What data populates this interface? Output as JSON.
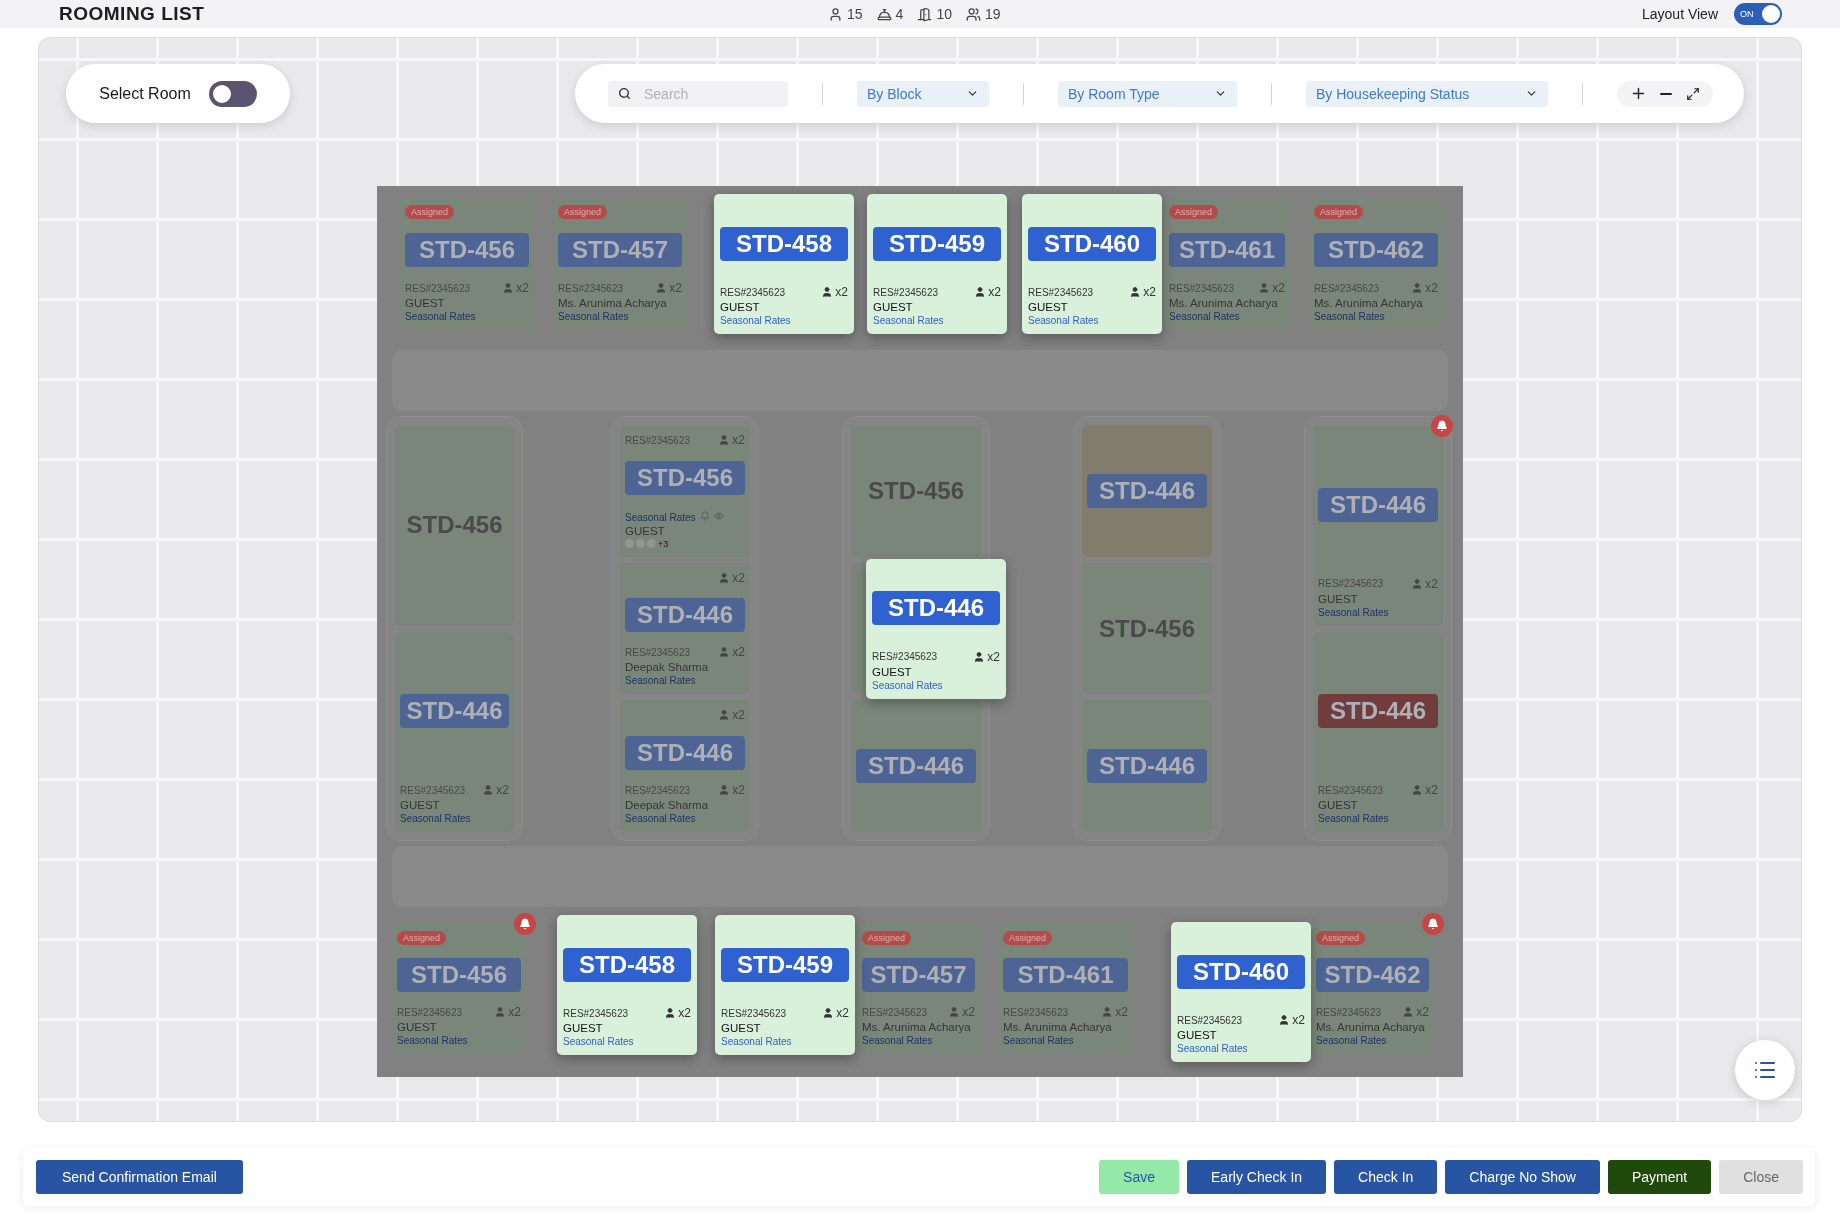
{
  "header": {
    "title": "ROOMING LIST",
    "counts": [
      {
        "kind": "person",
        "value": "15"
      },
      {
        "kind": "service",
        "value": "4"
      },
      {
        "kind": "door",
        "value": "10"
      },
      {
        "kind": "group",
        "value": "19"
      }
    ],
    "layout_view": {
      "label": "Layout View",
      "state_text": "ON",
      "on": true
    }
  },
  "select_room": {
    "label": "Select Room",
    "on": false
  },
  "filters": {
    "search": {
      "placeholder": "Search"
    },
    "dropdowns": [
      "By Block",
      "By Room Type",
      "By Housekeeping Status"
    ]
  },
  "floor_plan": {
    "top_row": [
      {
        "kind": "occupied",
        "room": "STD-456",
        "badge": "Assigned",
        "reservation": "RES#2345623",
        "guests": "x2",
        "guest": "GUEST",
        "rate": "Seasonal Rates",
        "highlighted": false,
        "color": "#7b867a",
        "tag": {
          "color": "#4d6494"
        },
        "alert": false
      },
      {
        "kind": "occupied",
        "room": "STD-457",
        "badge": "Assigned",
        "reservation": "RES#2345623",
        "guests": "x2",
        "guest": "Ms. Arunima Acharya",
        "rate": "Seasonal Rates",
        "highlighted": false,
        "color": "#7b867a",
        "tag": {
          "color": "#4d6494"
        },
        "alert": false
      },
      {
        "kind": "occupied",
        "room": "STD-458",
        "reservation": "RES#2345623",
        "guests": "x2",
        "guest": "GUEST",
        "rate": "Seasonal Rates",
        "highlighted": true,
        "color": "#d9f0da",
        "tag": {
          "color": "#2f62d0"
        },
        "alert": false
      },
      {
        "kind": "occupied",
        "room": "STD-459",
        "reservation": "RES#2345623",
        "guests": "x2",
        "guest": "GUEST",
        "rate": "Seasonal Rates",
        "highlighted": true,
        "color": "#d9f0da",
        "tag": {
          "color": "#2f62d0"
        },
        "alert": false
      },
      {
        "kind": "occupied",
        "room": "STD-460",
        "reservation": "RES#2345623",
        "guests": "x2",
        "guest": "GUEST",
        "rate": "Seasonal Rates",
        "highlighted": true,
        "color": "#d9f0da",
        "tag": {
          "color": "#2f62d0"
        },
        "alert": false
      },
      {
        "kind": "occupied",
        "room": "STD-461",
        "badge": "Assigned",
        "reservation": "RES#2345623",
        "guests": "x2",
        "guest": "Ms. Arunima Acharya",
        "rate": "Seasonal Rates",
        "highlighted": false,
        "color": "#7b867a",
        "tag": {
          "color": "#4d6494"
        },
        "alert": false
      },
      {
        "kind": "occupied",
        "room": "STD-462",
        "badge": "Assigned",
        "reservation": "RES#2345623",
        "guests": "x2",
        "guest": "Ms. Arunima Acharya",
        "rate": "Seasonal Rates",
        "highlighted": false,
        "color": "#7b867a",
        "tag": {
          "color": "#4d6494"
        },
        "alert": false
      }
    ],
    "blocks": [
      {
        "rooms": [
          {
            "kind": "vacant",
            "room": "STD-456",
            "highlighted": false,
            "color": "#7b867a",
            "alert": false
          },
          {
            "kind": "occupied",
            "room": "STD-446",
            "reservation": "RES#2345623",
            "guests": "x2",
            "guest": "GUEST",
            "rate": "Seasonal Rates",
            "highlighted": false,
            "color": "#7b867a",
            "tag": {
              "color": "#4d6494"
            },
            "alert": false
          }
        ]
      },
      {
        "rooms": [
          {
            "kind": "detailed",
            "room": "STD-456",
            "reservation": "RES#2345623",
            "guests": "x2",
            "guest": "GUEST",
            "rate": "Seasonal Rates",
            "more": "+3",
            "highlighted": false,
            "color": "#7b867a",
            "tag": {
              "color": "#4d6494"
            },
            "alert": false
          },
          {
            "kind": "occupied",
            "room": "STD-446",
            "top_guests": "x2",
            "reservation": "RES#2345623",
            "guests": "x2",
            "guest": "Deepak Sharma",
            "rate": "Seasonal Rates",
            "highlighted": false,
            "color": "#7b867a",
            "tag": {
              "color": "#4d6494"
            },
            "alert": false
          },
          {
            "kind": "occupied",
            "room": "STD-446",
            "top_guests": "x2",
            "reservation": "RES#2345623",
            "guests": "x2",
            "guest": "Deepak Sharma",
            "rate": "Seasonal Rates",
            "highlighted": false,
            "color": "#7b867a",
            "tag": {
              "color": "#4d6494"
            },
            "alert": false
          }
        ]
      },
      {
        "rooms": [
          {
            "kind": "vacant",
            "room": "STD-456",
            "highlighted": false,
            "color": "#7b867a",
            "alert": false
          },
          {
            "kind": "occupied",
            "room": "STD-446",
            "reservation": "RES#2345623",
            "guests": "x2",
            "guest": "GUEST",
            "rate": "Seasonal Rates",
            "highlighted": true,
            "color": "#d9f0da",
            "tag": {
              "color": "#2f62d0"
            },
            "alert": false
          },
          {
            "kind": "blocked",
            "room": "STD-446",
            "highlighted": false,
            "color": "#7b867a",
            "tag": {
              "color": "#4d6494"
            },
            "alert": false
          }
        ]
      },
      {
        "rooms": [
          {
            "kind": "blocked",
            "room": "STD-446",
            "highlighted": false,
            "color": "#807d6c",
            "tag": {
              "color": "#4d6494"
            },
            "alert": false
          },
          {
            "kind": "vacant",
            "room": "STD-456",
            "highlighted": false,
            "color": "#7b867a",
            "alert": false
          },
          {
            "kind": "blocked",
            "room": "STD-446",
            "highlighted": false,
            "color": "#7b867a",
            "tag": {
              "color": "#4d6494"
            },
            "alert": false
          }
        ]
      },
      {
        "rooms": [
          {
            "kind": "occupied",
            "room": "STD-446",
            "reservation": "RES#2345623",
            "guests": "x2",
            "guest": "GUEST",
            "rate": "Seasonal Rates",
            "highlighted": false,
            "color": "#7b867a",
            "tag": {
              "color": "#4d6494"
            },
            "alert": true
          },
          {
            "kind": "occupied",
            "room": "STD-446",
            "reservation": "RES#2345623",
            "guests": "x2",
            "guest": "GUEST",
            "rate": "Seasonal Rates",
            "highlighted": false,
            "color": "#7b867a",
            "tag": {
              "color": "#703c3c"
            },
            "alert": false
          }
        ]
      }
    ],
    "bottom_row": [
      {
        "kind": "occupied",
        "room": "STD-456",
        "badge": "Assigned",
        "reservation": "RES#2345623",
        "guests": "x2",
        "guest": "GUEST",
        "rate": "Seasonal Rates",
        "highlighted": false,
        "color": "#7b867a",
        "tag": {
          "color": "#4d6494"
        },
        "alert": true
      },
      {
        "kind": "occupied",
        "room": "STD-458",
        "reservation": "RES#2345623",
        "guests": "x2",
        "guest": "GUEST",
        "rate": "Seasonal Rates",
        "highlighted": true,
        "color": "#d9f0da",
        "tag": {
          "color": "#2f62d0"
        },
        "alert": false
      },
      {
        "kind": "occupied",
        "room": "STD-459",
        "reservation": "RES#2345623",
        "guests": "x2",
        "guest": "GUEST",
        "rate": "Seasonal Rates",
        "highlighted": true,
        "color": "#d9f0da",
        "tag": {
          "color": "#2f62d0"
        },
        "alert": false
      },
      {
        "kind": "occupied",
        "room": "STD-457",
        "badge": "Assigned",
        "reservation": "RES#2345623",
        "guests": "x2",
        "guest": "Ms. Arunima Acharya",
        "rate": "Seasonal Rates",
        "highlighted": false,
        "color": "#7b867a",
        "tag": {
          "color": "#4d6494"
        },
        "alert": false
      },
      {
        "kind": "occupied",
        "room": "STD-461",
        "badge": "Assigned",
        "reservation": "RES#2345623",
        "guests": "x2",
        "guest": "Ms. Arunima Acharya",
        "rate": "Seasonal Rates",
        "highlighted": false,
        "color": "#7b867a",
        "tag": {
          "color": "#4d6494"
        },
        "alert": false
      },
      {
        "kind": "occupied",
        "room": "STD-460",
        "reservation": "RES#2345623",
        "guests": "x2",
        "guest": "GUEST",
        "rate": "Seasonal Rates",
        "highlighted": true,
        "color": "#d9f0da",
        "tag": {
          "color": "#2f62d0"
        },
        "alert": false
      },
      {
        "kind": "occupied",
        "room": "STD-462",
        "badge": "Assigned",
        "reservation": "RES#2345623",
        "guests": "x2",
        "guest": "Ms. Arunima Acharya",
        "rate": "Seasonal Rates",
        "highlighted": false,
        "color": "#7b867a",
        "tag": {
          "color": "#4d6494"
        },
        "alert": true
      }
    ]
  },
  "actions": {
    "left": [
      {
        "label": "Send Confirmation Email",
        "kind": "primary"
      }
    ],
    "right": [
      {
        "label": "Save",
        "kind": "success"
      },
      {
        "label": "Early Check In",
        "kind": "primary"
      },
      {
        "label": "Check In",
        "kind": "primary"
      },
      {
        "label": "Charge No Show",
        "kind": "primary"
      },
      {
        "label": "Payment",
        "kind": "dark"
      },
      {
        "label": "Close",
        "kind": "muted"
      }
    ]
  }
}
